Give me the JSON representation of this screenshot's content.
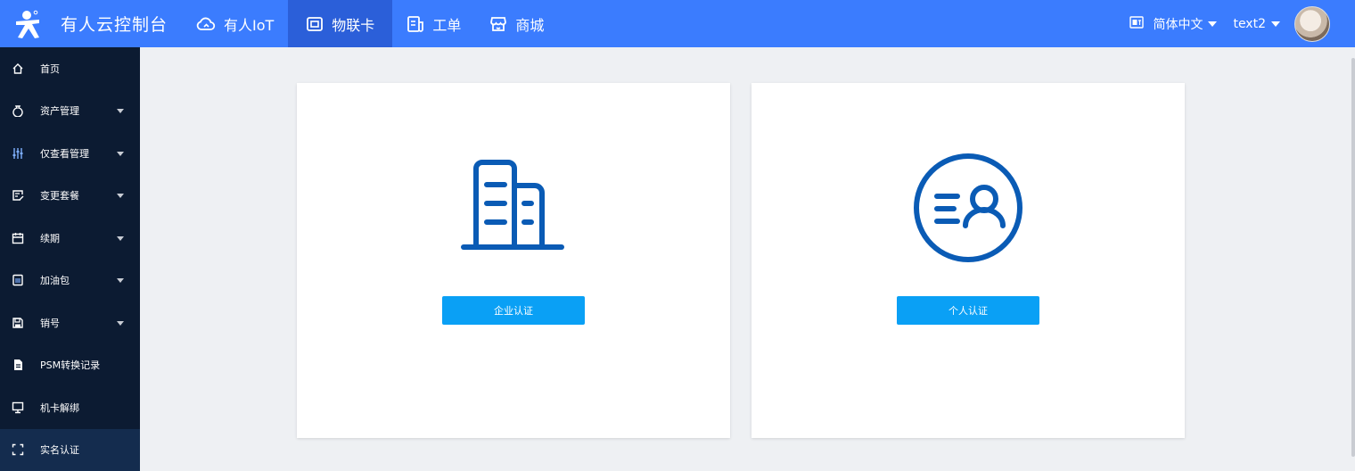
{
  "header": {
    "brand_title": "有人云控制台",
    "nav": [
      {
        "label": "有人IoT",
        "icon": "cloud-icon"
      },
      {
        "label": "物联卡",
        "icon": "sim-card-icon",
        "active": true
      },
      {
        "label": "工单",
        "icon": "document-icon"
      },
      {
        "label": "商城",
        "icon": "store-icon"
      }
    ],
    "language": "简体中文",
    "username": "text2",
    "accent_color": "#3b7cfe",
    "active_nav_color": "#2b5fd9"
  },
  "sidebar": {
    "items": [
      {
        "label": "首页",
        "icon": "home-icon",
        "has_submenu": false
      },
      {
        "label": "资产管理",
        "icon": "money-bag-icon",
        "has_submenu": true
      },
      {
        "label": "仅查看管理",
        "icon": "sliders-icon",
        "has_submenu": true
      },
      {
        "label": "变更套餐",
        "icon": "edit-note-icon",
        "has_submenu": true
      },
      {
        "label": "续期",
        "icon": "calendar-icon",
        "has_submenu": true
      },
      {
        "label": "加油包",
        "icon": "sim-chip-icon",
        "has_submenu": true
      },
      {
        "label": "销号",
        "icon": "floppy-icon",
        "has_submenu": true
      },
      {
        "label": "PSM转换记录",
        "icon": "file-icon",
        "has_submenu": false
      },
      {
        "label": "机卡解绑",
        "icon": "monitor-icon",
        "has_submenu": false
      },
      {
        "label": "实名认证",
        "icon": "scan-icon",
        "has_submenu": false,
        "active": true
      }
    ],
    "background": "#0c1b32"
  },
  "main": {
    "cards": [
      {
        "button_label": "企业认证",
        "icon": "building-icon"
      },
      {
        "button_label": "个人认证",
        "icon": "person-id-icon"
      }
    ],
    "button_color": "#0aa0f5",
    "icon_color": "#0a5bb5"
  }
}
